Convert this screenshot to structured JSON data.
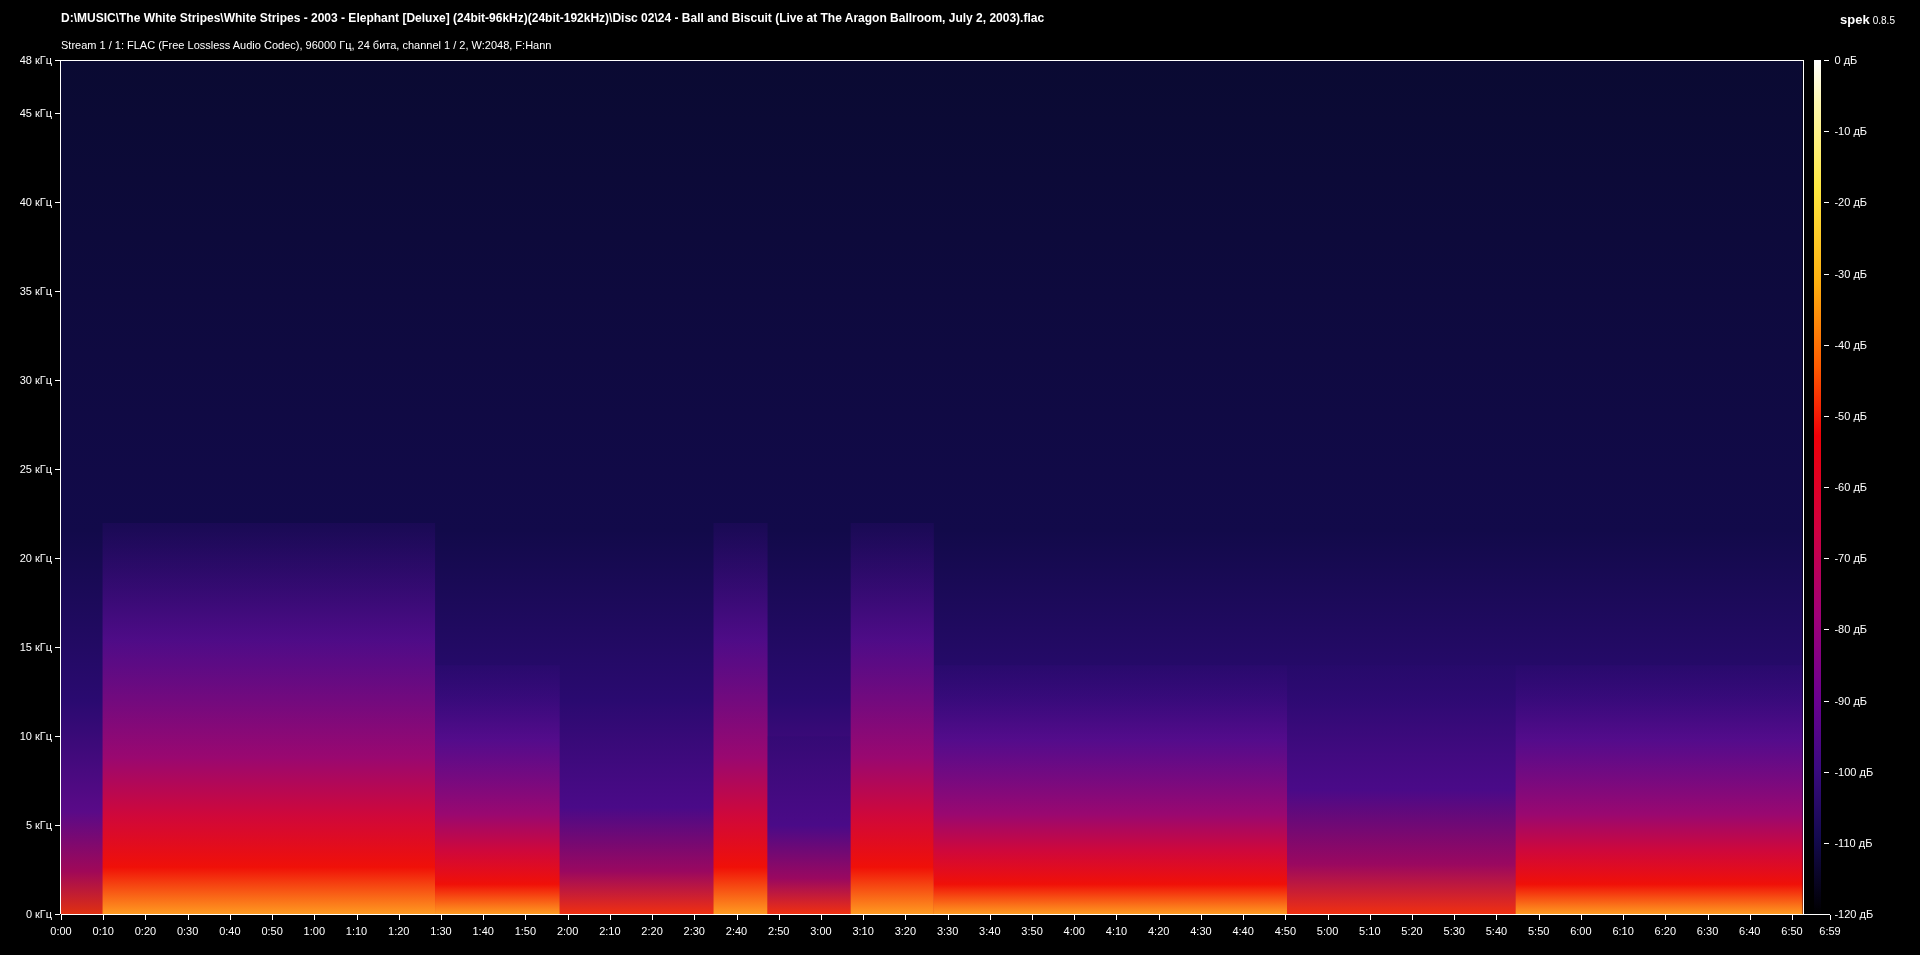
{
  "title": "D:\\MUSIC\\The White Stripes\\White Stripes - 2003 - Elephant [Deluxe] (24bit-96kHz)(24bit-192kHz)\\Disc 02\\24 - Ball and Biscuit (Live at The Aragon Ballroom, July 2, 2003).flac",
  "stream_info": "Stream 1 / 1: FLAC (Free Lossless Audio Codec), 96000 Гц, 24 бита, channel 1 / 2, W:2048, F:Hann",
  "app": {
    "name": "spek",
    "version": "0.8.5"
  },
  "frequency_axis": {
    "labels": [
      "48 кГц",
      "45 кГц",
      "40 кГц",
      "35 кГц",
      "30 кГц",
      "25 кГц",
      "20 кГц",
      "15 кГц",
      "10 кГц",
      "5 кГц",
      "0 кГц"
    ]
  },
  "time_axis": {
    "labels": [
      "0:00",
      "0:10",
      "0:20",
      "0:30",
      "0:40",
      "0:50",
      "1:00",
      "1:10",
      "1:20",
      "1:30",
      "1:40",
      "1:50",
      "2:00",
      "2:10",
      "2:20",
      "2:30",
      "2:40",
      "2:50",
      "3:00",
      "3:10",
      "3:20",
      "3:30",
      "3:40",
      "3:50",
      "4:00",
      "4:10",
      "4:20",
      "4:30",
      "4:40",
      "4:50",
      "5:00",
      "5:10",
      "5:20",
      "5:30",
      "5:40",
      "5:50",
      "6:00",
      "6:10",
      "6:20",
      "6:30",
      "6:40",
      "6:50",
      "6:59"
    ]
  },
  "db_scale": {
    "labels": [
      "0 дБ",
      "-10 дБ",
      "-20 дБ",
      "-30 дБ",
      "-40 дБ",
      "-50 дБ",
      "-60 дБ",
      "-70 дБ",
      "-80 дБ",
      "-90 дБ",
      "-100 дБ",
      "-110 дБ",
      "-120 дБ"
    ]
  }
}
